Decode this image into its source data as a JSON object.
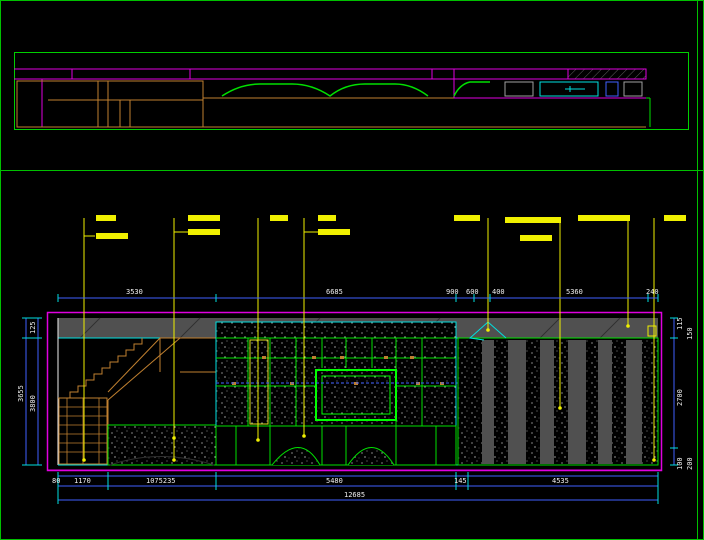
{
  "drawing": {
    "colors": {
      "frame": "#00c000",
      "magenta": "#e000e0",
      "yellow": "#f0f000",
      "cyan": "#00e0e0",
      "green": "#00ff00",
      "white": "#f0f0f0",
      "orange": "#c08030",
      "blue": "#4060ff",
      "gray": "#505050"
    },
    "top_dims": [
      "3530",
      "6685",
      "900",
      "600",
      "400",
      "5360",
      "240"
    ],
    "bottom_dims": [
      "80",
      "1170",
      "1075235",
      "5480",
      "145",
      "4535"
    ],
    "overall_width": "12685",
    "left_dims": [
      "3655",
      "3800",
      "125"
    ],
    "right_dims": [
      "115",
      "150",
      "2700",
      "200",
      "100"
    ],
    "callouts": [
      "",
      "",
      "",
      "",
      "",
      "",
      "",
      "",
      "",
      "",
      ""
    ]
  }
}
